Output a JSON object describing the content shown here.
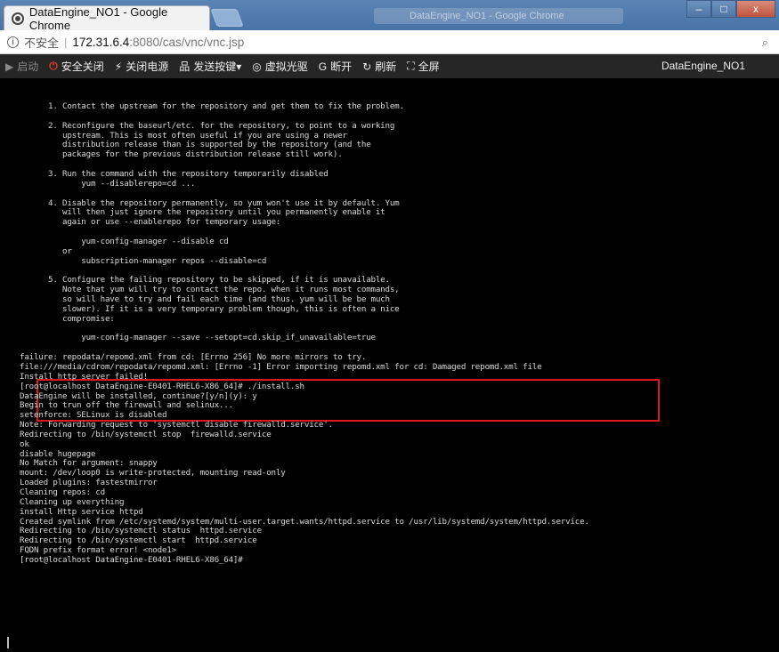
{
  "browser": {
    "tab_title": "DataEngine_NO1 - Google Chrome",
    "ghost_title": "DataEngine_NO1 - Google Chrome",
    "window_buttons": [
      "–",
      "□",
      "x"
    ],
    "insecure_label": "不安全",
    "url_host": "172.31.6.4",
    "url_path": ":8080/cas/vnc/vnc.jsp",
    "zoom_glyph": "🔍"
  },
  "toolbar": {
    "items": [
      {
        "icon": "▶",
        "label": "启动"
      },
      {
        "icon": "⏻",
        "label": "安全关闭"
      },
      {
        "icon": "⚡",
        "label": "关闭电源"
      },
      {
        "icon": "品",
        "label": "发送按键▾"
      },
      {
        "icon": "◎",
        "label": "虚拟光驱"
      },
      {
        "icon": "G",
        "label": "断开"
      },
      {
        "icon": "↻",
        "label": "刷新"
      },
      {
        "icon": "⛶",
        "label": "全屏"
      }
    ],
    "host_name": "DataEngine_NO1"
  },
  "terminal": {
    "lines": [
      "      1. Contact the upstream for the repository and get them to fix the problem.",
      "",
      "      2. Reconfigure the baseurl/etc. for the repository, to point to a working",
      "         upstream. This is most often useful if you are using a newer",
      "         distribution release than is supported by the repository (and the",
      "         packages for the previous distribution release still work).",
      "",
      "      3. Run the command with the repository temporarily disabled",
      "             yum --disablerepo=cd ...",
      "",
      "      4. Disable the repository permanently, so yum won't use it by default. Yum",
      "         will then just ignore the repository until you permanently enable it",
      "         again or use --enablerepo for temporary usage:",
      "",
      "             yum-config-manager --disable cd",
      "         or",
      "             subscription-manager repos --disable=cd",
      "",
      "      5. Configure the failing repository to be skipped, if it is unavailable.",
      "         Note that yum will try to contact the repo. when it runs most commands,",
      "         so will have to try and fail each time (and thus. yum will be be much",
      "         slower). If it is a very temporary problem though, this is often a nice",
      "         compromise:",
      "",
      "             yum-config-manager --save --setopt=cd.skip_if_unavailable=true",
      "",
      "failure: repodata/repomd.xml from cd: [Errno 256] No more mirrors to try.",
      "file:///media/cdrom/repodata/repomd.xml: [Errno -1] Error importing repomd.xml for cd: Damaged repomd.xml file",
      "Install http server failed!",
      "[root@localhost DataEngine-E0401-RHEL6-X86_64]# ./install.sh",
      "DataEngine will be installed, continue?[y/n](y): y",
      "Begin to trun off the firewall and selinux...",
      "setenforce: SELinux is disabled",
      "Note: Forwarding request to 'systemctl disable firewalld.service'.",
      "Redirecting to /bin/systemctl stop  firewalld.service",
      "ok",
      "disable hugepage",
      "No Match for argument: snappy",
      "mount: /dev/loop0 is write-protected, mounting read-only",
      "Loaded plugins: fastestmirror",
      "Cleaning repos: cd",
      "Cleaning up everything",
      "install Http service httpd",
      "Created symlink from /etc/systemd/system/multi-user.target.wants/httpd.service to /usr/lib/systemd/system/httpd.service.",
      "Redirecting to /bin/systemctl status  httpd.service",
      "Redirecting to /bin/systemctl start  httpd.service",
      "FQDN prefix format error! <node1>",
      "[root@localhost DataEngine-E0401-RHEL6-X86_64]#"
    ]
  }
}
